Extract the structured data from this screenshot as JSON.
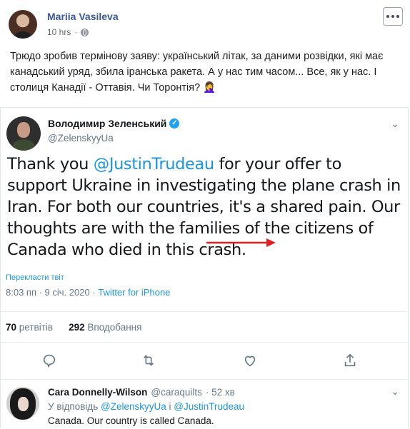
{
  "fb_post": {
    "author": "Mariia Vasileva",
    "time": "10 hrs",
    "text": "Трюдо зробив термінову заяву: український літак, за даними розвідки, які має канадський уряд, збила іранська ракета. А у нас тим часом... Все, як у нас. І столиця Канадії - Оттавія. Чи Торонтія? 🤦‍♀️",
    "more_icon": "more-icon"
  },
  "tweet": {
    "name": "Володимир Зеленський",
    "handle": "@ZelenskyyUa",
    "body_part1": "Thank you ",
    "body_mention": "@JustinTrudeau",
    "body_part2": " for your offer to support Ukraine in investigating the plane crash in Iran. For both our countries, it's a shared pain. Our thoughts are with the families of the citizens of Canada who died in this crash.",
    "translate": "Перекласти твіт",
    "timestamp": "8:03 пп · 9 січ. 2020 · ",
    "source": "Twitter for iPhone",
    "retweets_count": "70",
    "retweets_label": "ретвітів",
    "likes_count": "292",
    "likes_label": "Вподобання",
    "arrow_color": "#e02020"
  },
  "reply": {
    "name": "Cara Donnelly-Wilson",
    "handle": "@caraquilts",
    "time": "· 52 хв",
    "replying_prefix": "У відповідь ",
    "replying_mention1": "@ZelenskyyUa",
    "replying_and": " і ",
    "replying_mention2": "@JustinTrudeau",
    "text": "Canada. Our country is called Canada."
  }
}
